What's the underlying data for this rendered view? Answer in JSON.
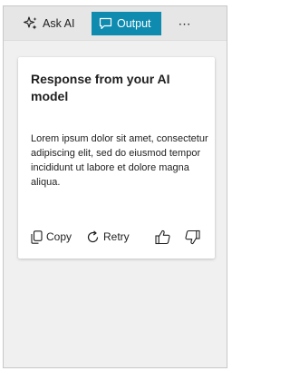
{
  "toolbar": {
    "ask_label": "Ask AI",
    "output_label": "Output",
    "more_label": "⋯",
    "accent_color": "#0f8bb0"
  },
  "card": {
    "title": "Response from your AI model",
    "body": "Lorem ipsum dolor sit amet, consectetur adipiscing elit, sed do eiusmod tempor incididunt ut labore et dolore magna aliqua.",
    "copy_label": "Copy",
    "retry_label": "Retry"
  },
  "icons": {
    "ask": "sparkle-icon",
    "output": "chat-icon",
    "more": "more-icon",
    "copy": "copy-icon",
    "retry": "retry-icon",
    "like": "thumbs-up-icon",
    "dislike": "thumbs-down-icon"
  }
}
